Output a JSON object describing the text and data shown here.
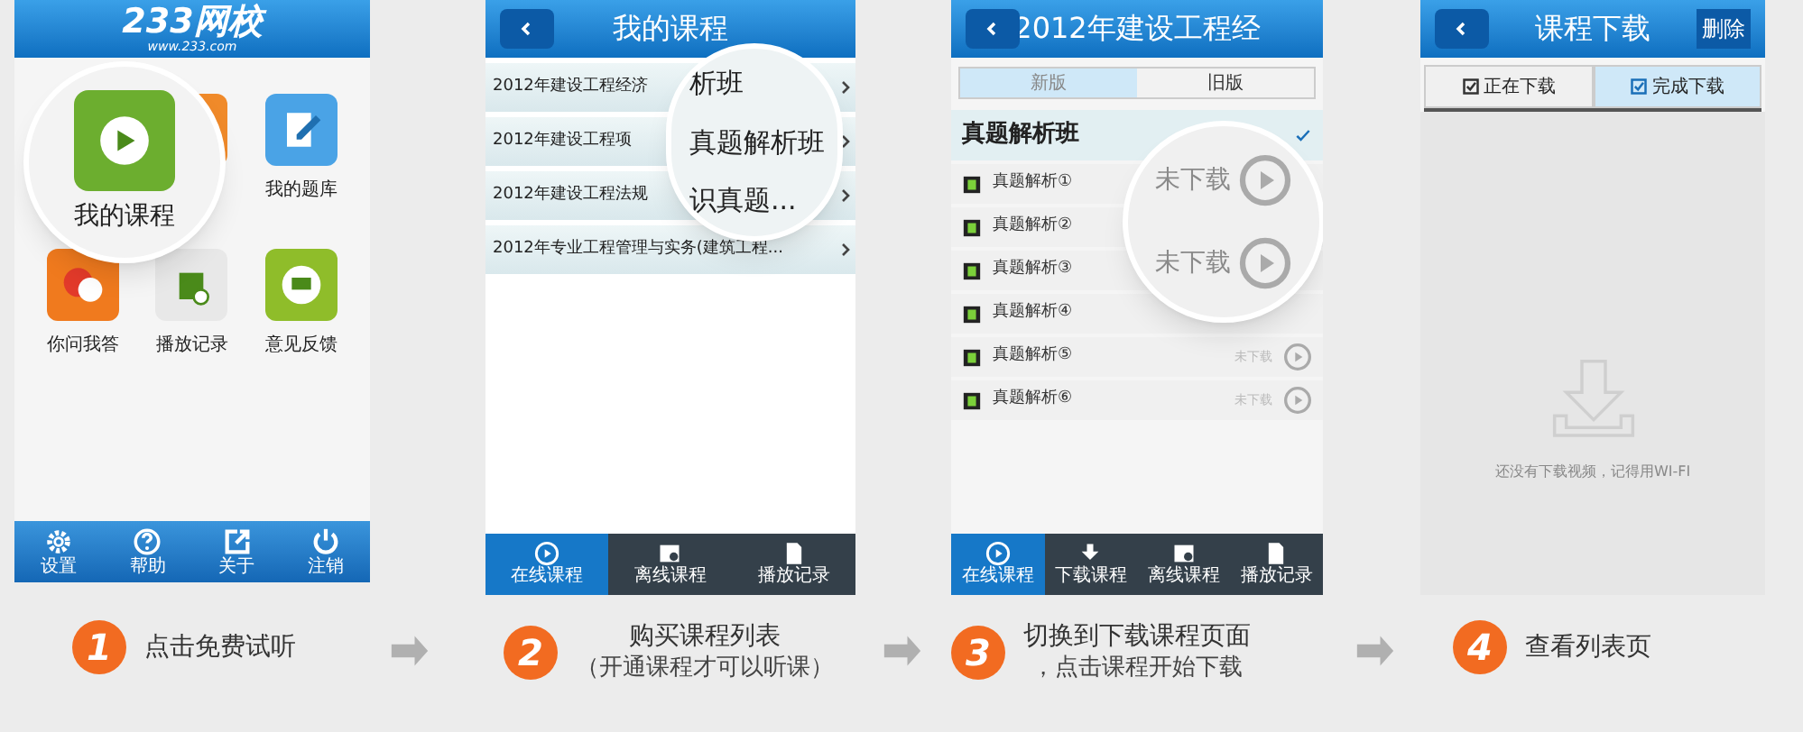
{
  "screens": [
    {
      "kind": "home",
      "logo": "233网校",
      "logo_url": "www.233.com",
      "apps": [
        {
          "label": "我的课程",
          "magnified": true
        },
        {
          "magnified": false
        },
        {
          "label": "我的题库",
          "magnified": false
        },
        {
          "label": "你问我答",
          "magnified": false
        },
        {
          "label": "播放记录",
          "magnified": false
        },
        {
          "label": "意见反馈",
          "magnified": false
        }
      ],
      "bottom_bar": [
        "设置",
        "帮助",
        "关于",
        "注销"
      ]
    },
    {
      "kind": "courses",
      "title": "我的课程",
      "rows": [
        "2012年建设工程经济",
        "2012年建设工程项",
        "2012年建设工程法规",
        "2012年专业工程管理与实务(建筑工程..."
      ],
      "magnifier": [
        "析班",
        "真题解析班",
        "识真题..."
      ],
      "tabs": [
        {
          "label": "在线课程",
          "selected": true
        },
        {
          "label": "离线课程",
          "selected": false
        },
        {
          "label": "播放记录",
          "selected": false
        }
      ]
    },
    {
      "kind": "lessons",
      "title": "2012年建设工程经",
      "segments": [
        {
          "label": "新版",
          "selected": true
        },
        {
          "label": "旧版",
          "selected": false
        }
      ],
      "section": "真题解析班",
      "items": [
        {
          "label": "真题解析①"
        },
        {
          "label": "真题解析②"
        },
        {
          "label": "真题解析③"
        },
        {
          "label": "真题解析④"
        },
        {
          "label": "真题解析⑤",
          "status": "未下载"
        },
        {
          "label": "真题解析⑥",
          "status": "未下载"
        }
      ],
      "magnifier": [
        "未下载",
        "未下载"
      ],
      "tabs": [
        {
          "label": "在线课程",
          "selected": true
        },
        {
          "label": "下载课程",
          "selected": false
        },
        {
          "label": "离线课程",
          "selected": false
        },
        {
          "label": "播放记录",
          "selected": false
        }
      ]
    },
    {
      "kind": "downloads",
      "title": "课程下载",
      "action": "删除",
      "tabs": [
        {
          "label": "正在下载",
          "selected": false
        },
        {
          "label": "完成下载",
          "selected": true
        }
      ],
      "empty_text": "还没有下载视频，记得用WI-FI"
    }
  ],
  "steps": [
    {
      "number": "1",
      "lines": [
        "点击免费试听"
      ]
    },
    {
      "number": "2",
      "lines": [
        "购买课程列表",
        "（开通课程才可以听课）"
      ]
    },
    {
      "number": "3",
      "lines": [
        "切换到下载课程页面",
        "，点击课程开始下载"
      ]
    },
    {
      "number": "4",
      "lines": [
        "查看列表页"
      ]
    }
  ]
}
